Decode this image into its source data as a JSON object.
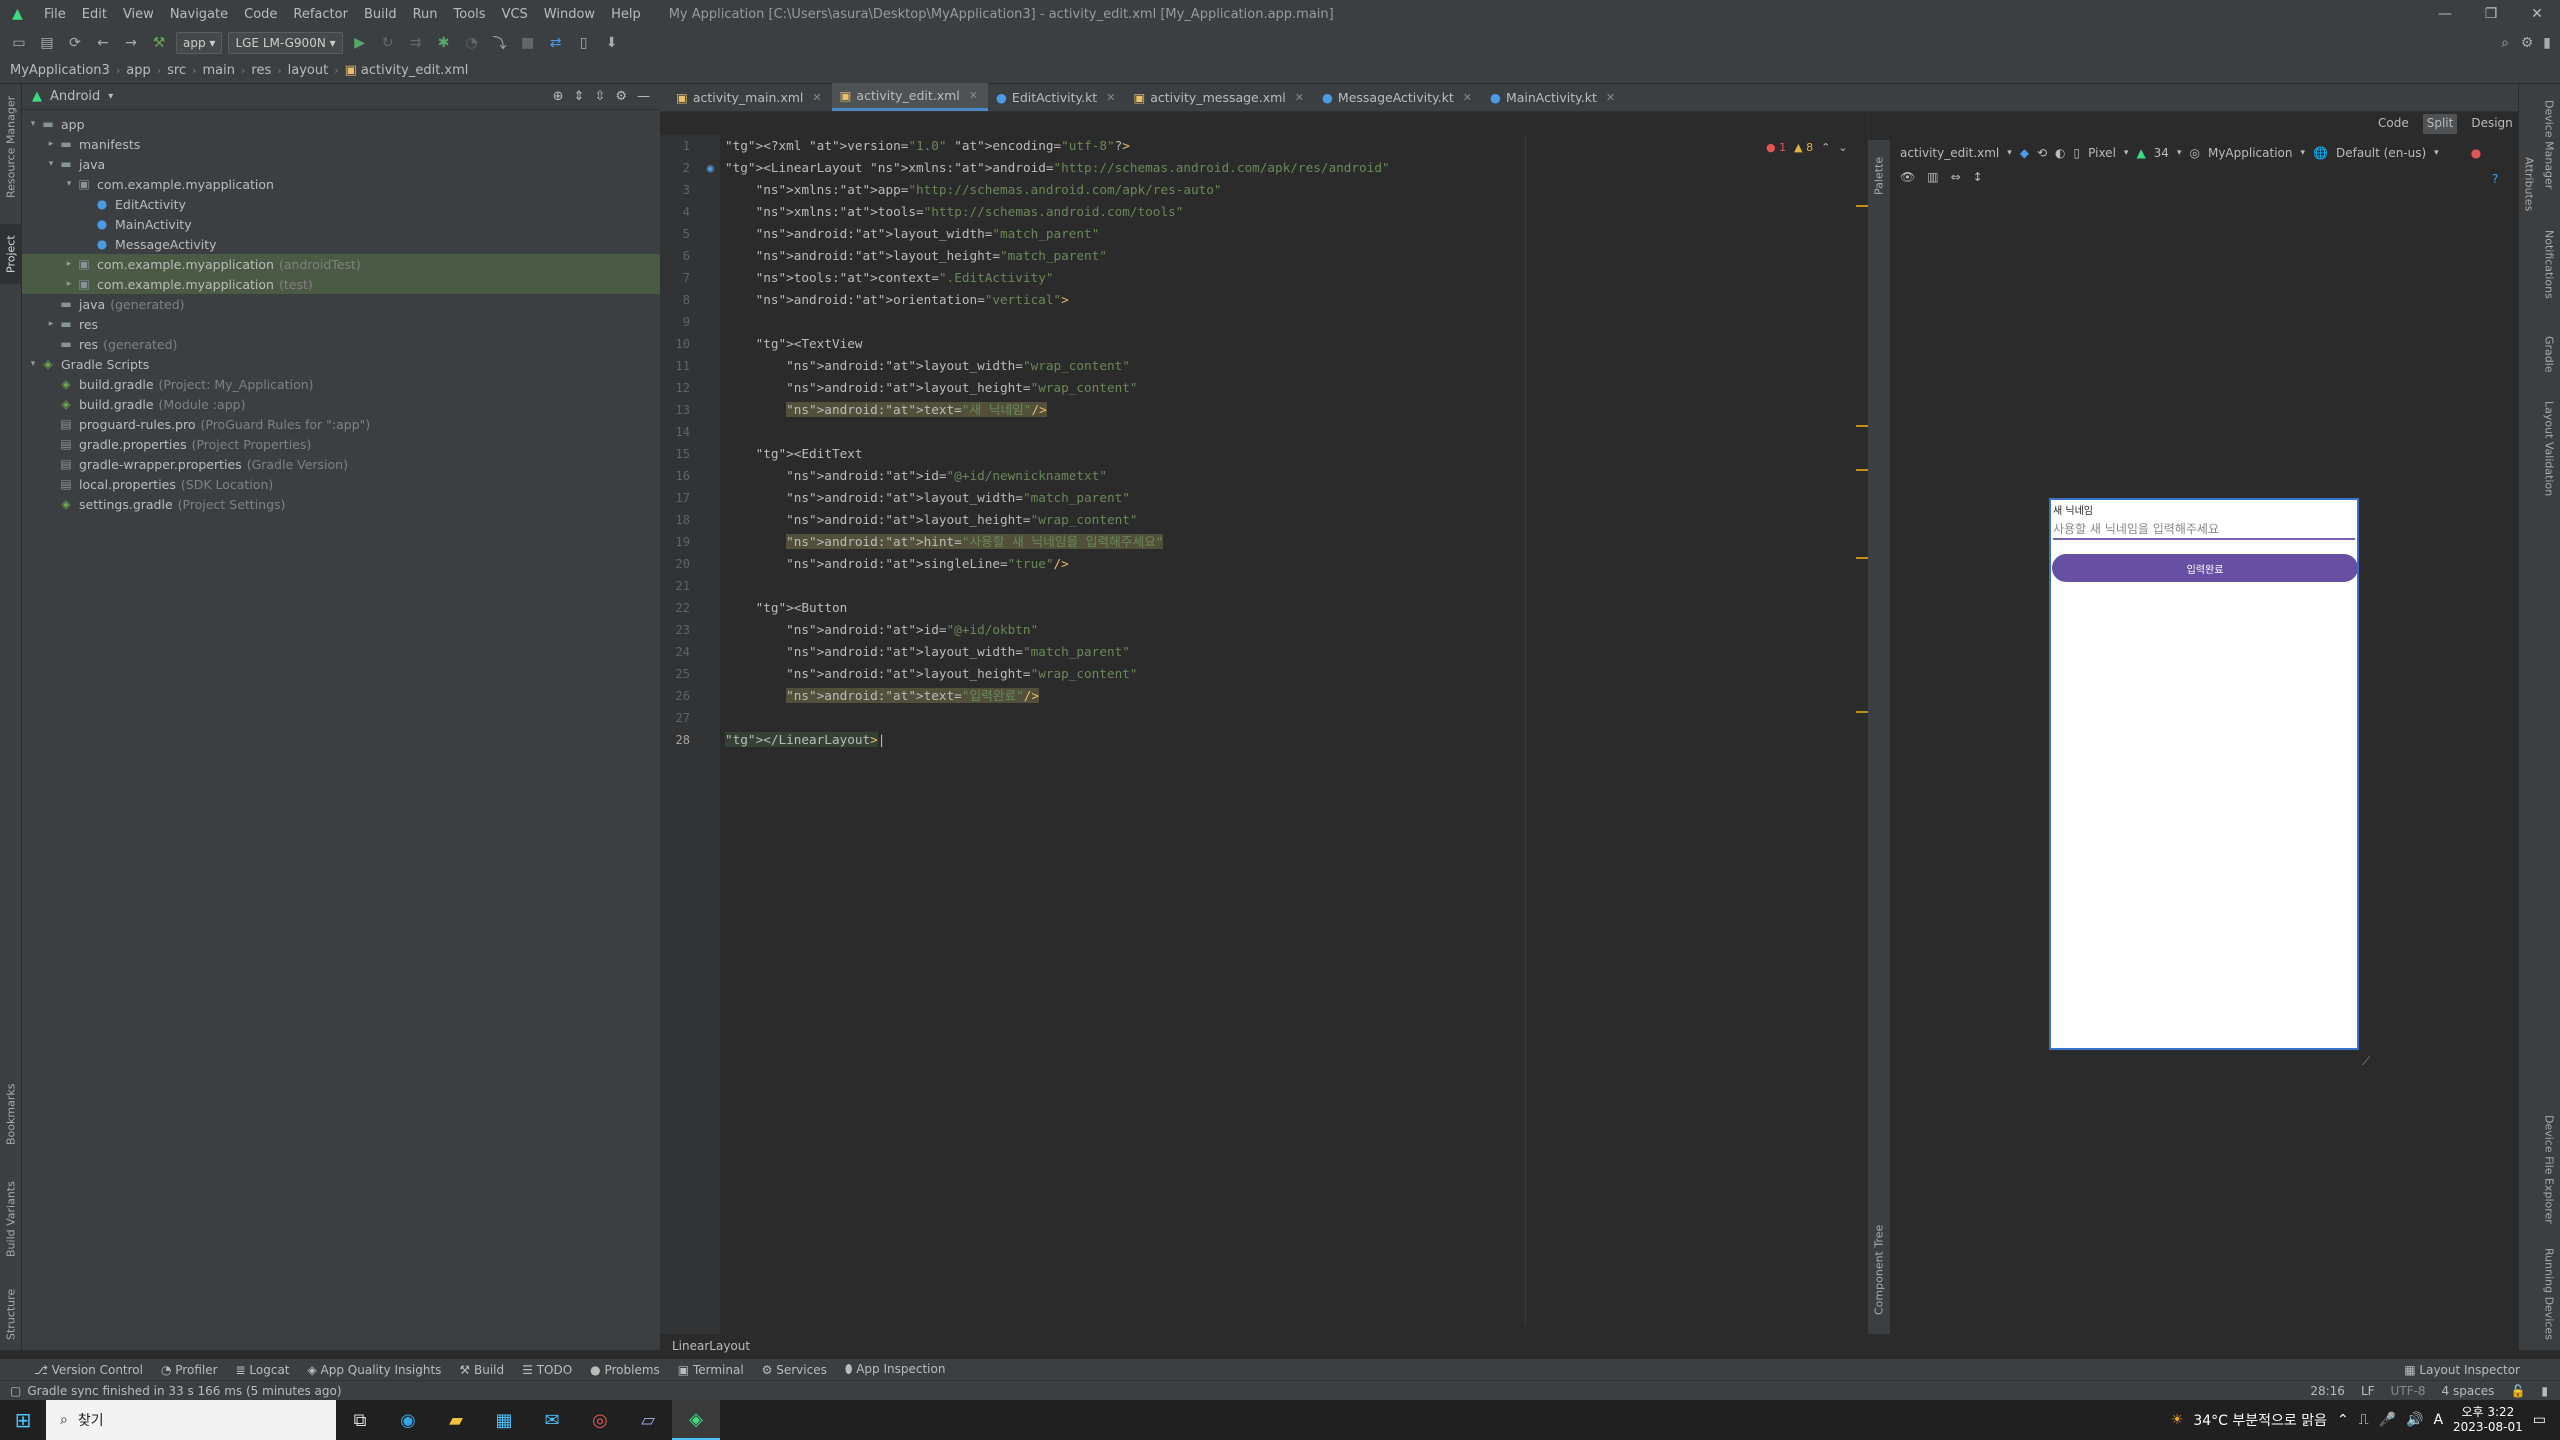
{
  "window": {
    "menu": [
      "File",
      "Edit",
      "View",
      "Navigate",
      "Code",
      "Refactor",
      "Build",
      "Run",
      "Tools",
      "VCS",
      "Window",
      "Help"
    ],
    "title": "My Application [C:\\Users\\asura\\Desktop\\MyApplication3] - activity_edit.xml [My_Application.app.main]"
  },
  "toolbar": {
    "run_config": "app",
    "device": "LGE LM-G900N"
  },
  "breadcrumb": [
    "MyApplication3",
    "app",
    "src",
    "main",
    "res",
    "layout",
    "activity_edit.xml"
  ],
  "project": {
    "view_mode": "Android",
    "tree": [
      {
        "label": "app",
        "hint": "",
        "indent": 0,
        "arrow": "▾",
        "icon": "folder"
      },
      {
        "label": "manifests",
        "hint": "",
        "indent": 1,
        "arrow": "▸",
        "icon": "folder"
      },
      {
        "label": "java",
        "hint": "",
        "indent": 1,
        "arrow": "▾",
        "icon": "folder"
      },
      {
        "label": "com.example.myapplication",
        "hint": "",
        "indent": 2,
        "arrow": "▾",
        "icon": "pkg"
      },
      {
        "label": "EditActivity",
        "hint": "",
        "indent": 3,
        "arrow": "",
        "icon": "kt"
      },
      {
        "label": "MainActivity",
        "hint": "",
        "indent": 3,
        "arrow": "",
        "icon": "kt"
      },
      {
        "label": "MessageActivity",
        "hint": "",
        "indent": 3,
        "arrow": "",
        "icon": "kt"
      },
      {
        "label": "com.example.myapplication",
        "hint": "(androidTest)",
        "indent": 2,
        "arrow": "▸",
        "icon": "pkg",
        "sel": true
      },
      {
        "label": "com.example.myapplication",
        "hint": "(test)",
        "indent": 2,
        "arrow": "▸",
        "icon": "pkg",
        "sel": true
      },
      {
        "label": "java",
        "hint": "(generated)",
        "indent": 1,
        "arrow": "",
        "icon": "folder"
      },
      {
        "label": "res",
        "hint": "",
        "indent": 1,
        "arrow": "▸",
        "icon": "folder"
      },
      {
        "label": "res",
        "hint": "(generated)",
        "indent": 1,
        "arrow": "",
        "icon": "folder"
      },
      {
        "label": "Gradle Scripts",
        "hint": "",
        "indent": 0,
        "arrow": "▾",
        "icon": "gradle"
      },
      {
        "label": "build.gradle",
        "hint": "(Project: My_Application)",
        "indent": 1,
        "arrow": "",
        "icon": "gradle"
      },
      {
        "label": "build.gradle",
        "hint": "(Module :app)",
        "indent": 1,
        "arrow": "",
        "icon": "gradle"
      },
      {
        "label": "proguard-rules.pro",
        "hint": "(ProGuard Rules for \":app\")",
        "indent": 1,
        "arrow": "",
        "icon": "file"
      },
      {
        "label": "gradle.properties",
        "hint": "(Project Properties)",
        "indent": 1,
        "arrow": "",
        "icon": "file"
      },
      {
        "label": "gradle-wrapper.properties",
        "hint": "(Gradle Version)",
        "indent": 1,
        "arrow": "",
        "icon": "file"
      },
      {
        "label": "local.properties",
        "hint": "(SDK Location)",
        "indent": 1,
        "arrow": "",
        "icon": "file"
      },
      {
        "label": "settings.gradle",
        "hint": "(Project Settings)",
        "indent": 1,
        "arrow": "",
        "icon": "gradle"
      }
    ]
  },
  "tabs": [
    {
      "label": "activity_main.xml",
      "icon": "xml",
      "active": false
    },
    {
      "label": "activity_edit.xml",
      "icon": "xml",
      "active": true
    },
    {
      "label": "EditActivity.kt",
      "icon": "kt",
      "active": false
    },
    {
      "label": "activity_message.xml",
      "icon": "xml",
      "active": false
    },
    {
      "label": "MessageActivity.kt",
      "icon": "kt",
      "active": false
    },
    {
      "label": "MainActivity.kt",
      "icon": "kt",
      "active": false
    }
  ],
  "editor": {
    "errors": "1",
    "warnings": "8",
    "line_count": 28,
    "lines": [
      "<?xml version=\"1.0\" encoding=\"utf-8\"?>",
      "<LinearLayout xmlns:android=\"http://schemas.android.com/apk/res/android\"",
      "    xmlns:app=\"http://schemas.android.com/apk/res-auto\"",
      "    xmlns:tools=\"http://schemas.android.com/tools\"",
      "    android:layout_width=\"match_parent\"",
      "    android:layout_height=\"match_parent\"",
      "    tools:context=\".EditActivity\"",
      "    android:orientation=\"vertical\">",
      "",
      "    <TextView",
      "        android:layout_width=\"wrap_content\"",
      "        android:layout_height=\"wrap_content\"",
      "        android:text=\"새 닉네임\"/>",
      "",
      "    <EditText",
      "        android:id=\"@+id/newnicknametxt\"",
      "        android:layout_width=\"match_parent\"",
      "        android:layout_height=\"wrap_content\"",
      "        android:hint=\"사용할 새 닉네임을 입력해주세요\"",
      "        android:singleLine=\"true\"/>",
      "",
      "    <Button",
      "        android:id=\"@+id/okbtn\"",
      "        android:layout_width=\"match_parent\"",
      "        android:layout_height=\"wrap_content\"",
      "        android:text=\"입력완료\"/>",
      "",
      "</LinearLayout>"
    ],
    "status_path": "LinearLayout"
  },
  "design": {
    "modes": [
      "Code",
      "Split",
      "Design"
    ],
    "active_mode": "Split",
    "file": "activity_edit.xml",
    "device": "Pixel",
    "api": "34",
    "theme": "MyApplication",
    "locale": "Default (en-us)",
    "preview": {
      "textview": "새 닉네임",
      "hint": "사용할 새 닉네임을 입력해주세요",
      "button": "입력완료"
    }
  },
  "side_tabs": {
    "left_top": [
      "Resource Manager",
      "Project"
    ],
    "left_bottom": [
      "Bookmarks",
      "Build Variants",
      "Structure"
    ],
    "right": [
      "Device Manager",
      "Notifications",
      "Gradle",
      "Layout Validation",
      "Device File Explorer",
      "Running Devices"
    ],
    "palette": "Palette",
    "attributes": "Attributes",
    "component_tree": "Component Tree"
  },
  "bottom_tabs": [
    "Version Control",
    "Profiler",
    "Logcat",
    "App Quality Insights",
    "Build",
    "TODO",
    "Problems",
    "Terminal",
    "Services",
    "App Inspection"
  ],
  "layout_inspector": "Layout Inspector",
  "status": {
    "message": "Gradle sync finished in 33 s 166 ms (5 minutes ago)",
    "position": "28:16",
    "line_sep": "LF",
    "encoding": "UTF-8",
    "indent": "4 spaces"
  },
  "taskbar": {
    "search": "찾기",
    "weather": "34°C  부분적으로 맑음",
    "ime": "A",
    "time": "오후 3:22",
    "date": "2023-08-01"
  }
}
